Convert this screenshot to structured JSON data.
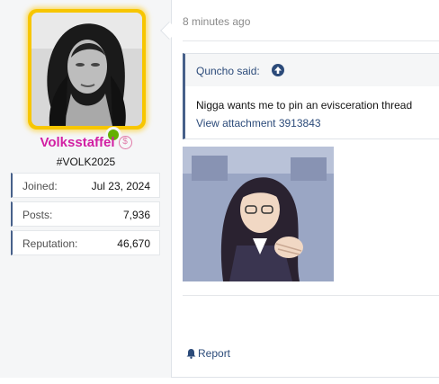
{
  "user": {
    "username": "Volksstaffel",
    "user_title": "#VOLK2025",
    "banner_icon": "$",
    "online": true,
    "stats": [
      {
        "label": "Joined:",
        "value": "Jul 23, 2024"
      },
      {
        "label": "Posts:",
        "value": "7,936"
      },
      {
        "label": "Reputation:",
        "value": "46,670"
      }
    ]
  },
  "post": {
    "time": "8 minutes ago",
    "quote": {
      "author": "Quncho said:",
      "text": "Nigga wants me to pin an evisceration thread",
      "attachment_link": "View attachment 3913843"
    },
    "report_label": "Report"
  },
  "colors": {
    "username": "#d21fa3",
    "avatar_border": "#f7c600",
    "online": "#63b000",
    "link": "#2c4b7a",
    "accent": "#47608a"
  }
}
